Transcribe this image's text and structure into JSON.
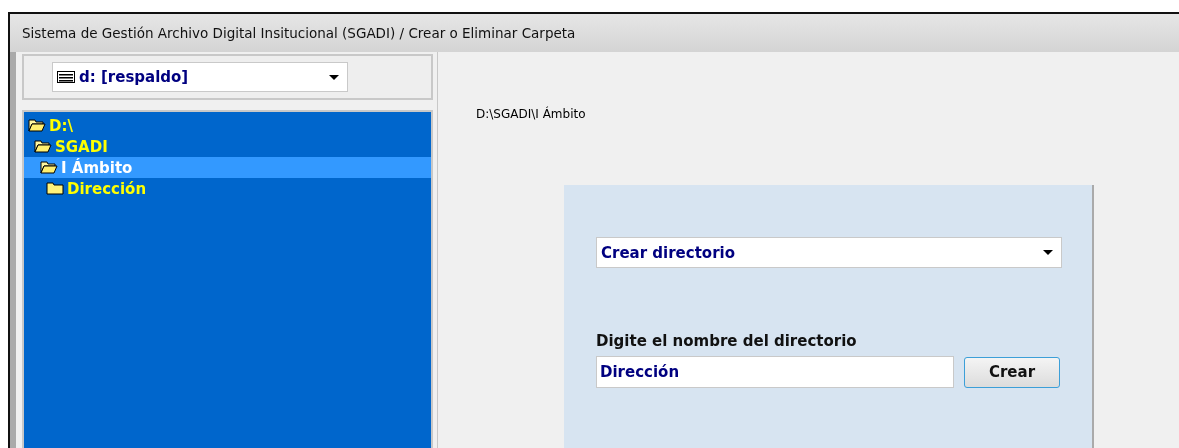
{
  "window": {
    "title": "Sistema de Gestión Archivo Digital Insitucional (SGADI) / Crear o Eliminar Carpeta"
  },
  "drive_select": {
    "value": "d: [respaldo]"
  },
  "folder_tree": [
    {
      "label": "D:\\",
      "expanded": true,
      "selected": false,
      "children": [
        {
          "label": "SGADI",
          "expanded": true,
          "selected": false,
          "children": [
            {
              "label": "I Ámbito",
              "expanded": true,
              "selected": true,
              "children": [
                {
                  "label": "Dirección",
                  "expanded": false,
                  "selected": false
                }
              ]
            }
          ]
        }
      ]
    }
  ],
  "current_path": "D:\\SGADI\\I Ámbito",
  "action_select": {
    "value": "Crear directorio"
  },
  "name_field": {
    "label": "Digite el nombre del directorio",
    "value": "Dirección"
  },
  "buttons": [
    {
      "label": "Crear"
    }
  ]
}
